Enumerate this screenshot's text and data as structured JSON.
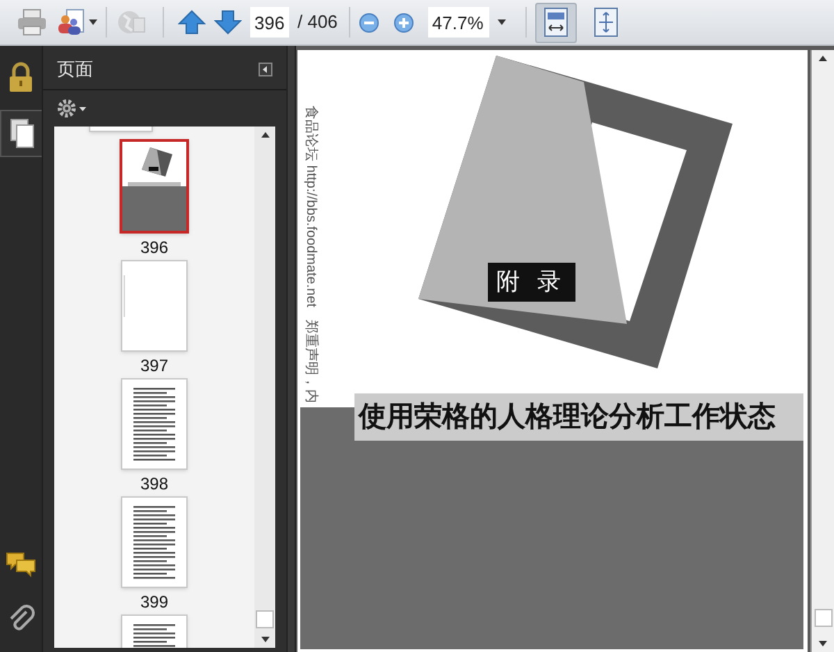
{
  "toolbar": {
    "page_field": {
      "value": "396"
    },
    "page_count": "/ 406",
    "zoom_field": {
      "value": "47.7%"
    },
    "view_buttons": [
      {
        "kind": "fit-width",
        "selected": true
      },
      {
        "kind": "fit-page",
        "selected": false
      }
    ]
  },
  "left_rail": [
    {
      "kind": "lock",
      "selected": false
    },
    {
      "kind": "pages",
      "selected": true
    },
    {
      "kind": "comments",
      "selected": false
    },
    {
      "kind": "attachment",
      "selected": false
    }
  ],
  "side_panel": {
    "title": "页面",
    "thumbnails": [
      {
        "kind": "cover",
        "label": "396",
        "selected": true
      },
      {
        "kind": "blank",
        "label": "397",
        "selected": false
      },
      {
        "kind": "text",
        "label": "398",
        "selected": false
      },
      {
        "kind": "text",
        "label": "399",
        "selected": false
      },
      {
        "kind": "text",
        "selected": false
      }
    ]
  },
  "document_page": {
    "margin_notes": [
      "食品论坛 http://bbs.foodmate.net",
      "郑重声明，内"
    ],
    "badge": "附 录",
    "title": "使用荣格的人格理论分析工作状态"
  }
}
